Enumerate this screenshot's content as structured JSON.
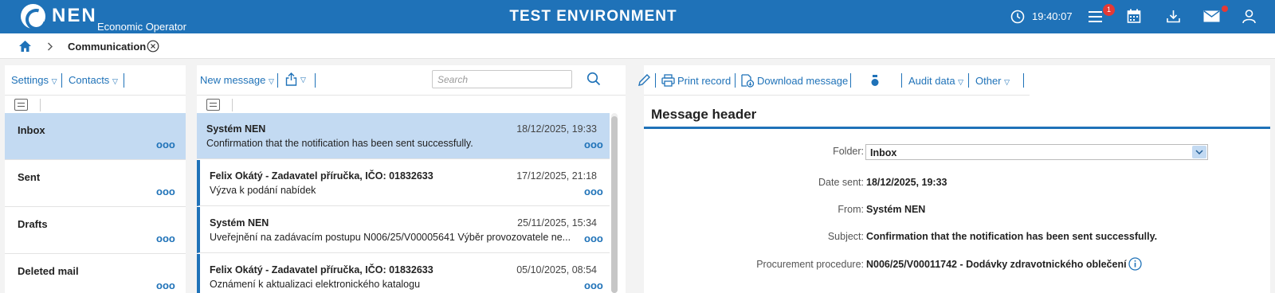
{
  "header": {
    "logo_text": "NEN",
    "logo_sub": "Economic Operator",
    "environment": "TEST ENVIRONMENT",
    "time": "19:40:07",
    "notification_count": "1"
  },
  "breadcrumb": {
    "current": "Communication"
  },
  "folders_panel": {
    "toolbar": {
      "settings": "Settings",
      "contacts": "Contacts"
    },
    "items": [
      {
        "name": "Inbox",
        "active": true
      },
      {
        "name": "Sent"
      },
      {
        "name": "Drafts"
      },
      {
        "name": "Deleted mail"
      }
    ],
    "more_glyph": "ooo"
  },
  "messages_panel": {
    "toolbar": {
      "new_message": "New message",
      "search_placeholder": "Search"
    },
    "items": [
      {
        "sender": "Systém NEN",
        "date": "18/12/2025, 19:33",
        "subject": "Confirmation that the notification has been sent successfully."
      },
      {
        "sender": "Felix Okátý - Zadavatel příručka, IČO: 01832633",
        "date": "17/12/2025, 21:18",
        "subject": "Výzva k podání nabídek"
      },
      {
        "sender": "Systém NEN",
        "date": "25/11/2025, 15:34",
        "subject": "Uveřejnění na zadávacím postupu N006/25/V00005641 Výběr provozovatele ne..."
      },
      {
        "sender": "Felix Okátý - Zadavatel příručka, IČO: 01832633",
        "date": "05/10/2025, 08:54",
        "subject": "Oznámení k aktualizaci elektronického katalogu"
      }
    ]
  },
  "detail_panel": {
    "toolbar": {
      "print_record": "Print record",
      "download_message": "Download message",
      "audit_data": "Audit data",
      "other": "Other"
    },
    "section_title": "Message header",
    "fields": {
      "folder_label": "Folder:",
      "folder_value": "Inbox",
      "date_sent_label": "Date sent:",
      "date_sent_value": "18/12/2025, 19:33",
      "from_label": "From:",
      "from_value": "Systém NEN",
      "subject_label": "Subject:",
      "subject_value": "Confirmation that the notification has been sent successfully.",
      "procedure_label": "Procurement procedure:",
      "procedure_value": "N006/25/V00011742 - Dodávky zdravotnického oblečení"
    }
  },
  "colors": {
    "brand": "#1f72b8",
    "selected_row": "#c3daf2",
    "badge": "#e53935"
  },
  "icons": [
    "home-icon",
    "chevron-right-icon",
    "close-circle-icon",
    "clock-icon",
    "menu-icon",
    "calendar-icon",
    "download-icon",
    "mail-icon",
    "user-icon",
    "filter-icon",
    "share-icon",
    "search-icon",
    "edit-icon",
    "print-icon",
    "download-message-icon",
    "badge-icon",
    "chevron-down-icon",
    "info-icon"
  ]
}
